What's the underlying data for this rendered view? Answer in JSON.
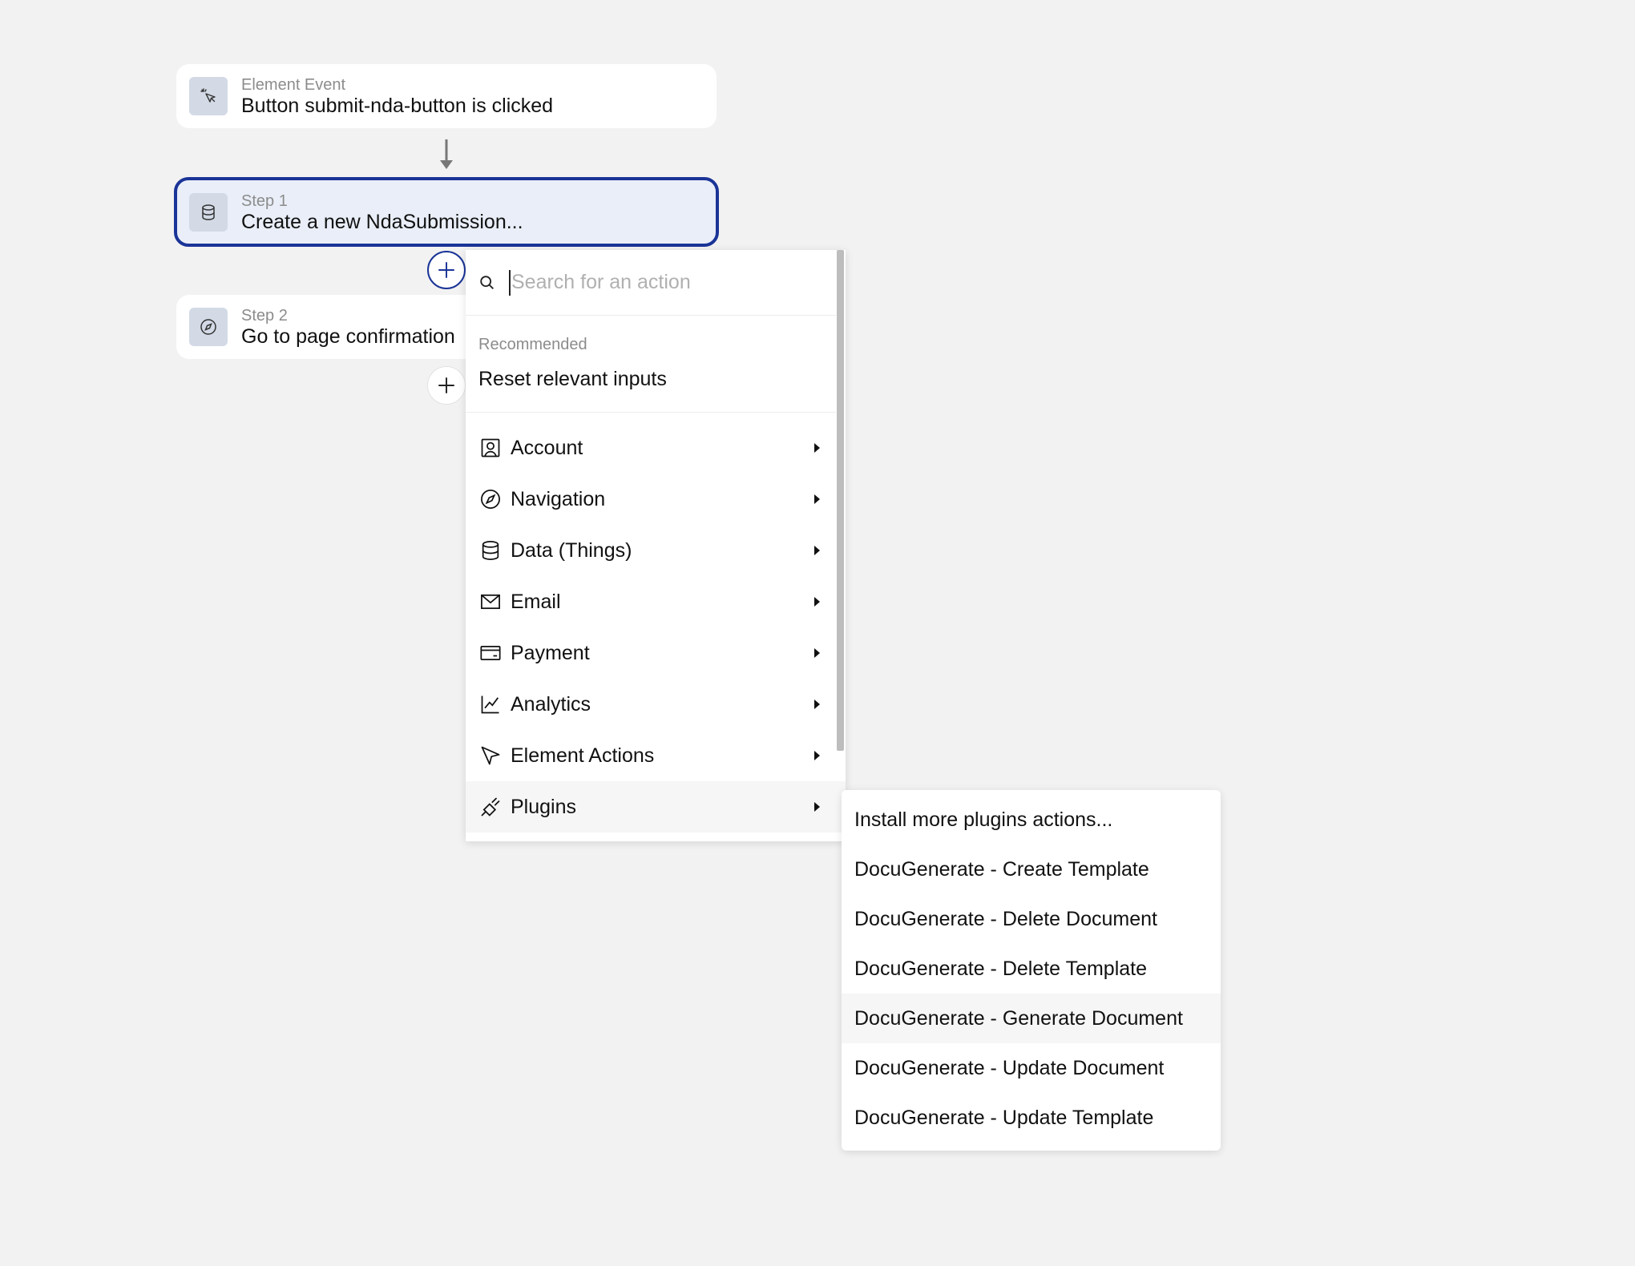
{
  "workflow": {
    "event": {
      "subtitle": "Element Event",
      "title": "Button submit-nda-button is clicked",
      "icon": "cursor-click-icon"
    },
    "steps": [
      {
        "subtitle": "Step 1",
        "title": "Create a new NdaSubmission...",
        "icon": "database-icon",
        "selected": true
      },
      {
        "subtitle": "Step 2",
        "title": "Go to page confirmation",
        "icon": "compass-icon",
        "selected": false
      }
    ]
  },
  "action_menu": {
    "search": {
      "placeholder": "Search for an action",
      "value": ""
    },
    "recommended_label": "Recommended",
    "recommended": [
      "Reset relevant inputs"
    ],
    "categories": [
      {
        "label": "Account",
        "icon": "account-icon"
      },
      {
        "label": "Navigation",
        "icon": "compass-icon"
      },
      {
        "label": "Data (Things)",
        "icon": "database-icon"
      },
      {
        "label": "Email",
        "icon": "envelope-icon"
      },
      {
        "label": "Payment",
        "icon": "credit-card-icon"
      },
      {
        "label": "Analytics",
        "icon": "line-chart-icon"
      },
      {
        "label": "Element Actions",
        "icon": "pointer-icon"
      },
      {
        "label": "Plugins",
        "icon": "plug-icon",
        "active": true
      }
    ]
  },
  "plugins_submenu": {
    "items": [
      "Install more plugins actions...",
      "DocuGenerate - Create Template",
      "DocuGenerate - Delete Document",
      "DocuGenerate - Delete Template",
      "DocuGenerate - Generate Document",
      "DocuGenerate - Update Document",
      "DocuGenerate - Update Template"
    ],
    "hovered_index": 4
  },
  "colors": {
    "accent": "#1a3497",
    "selected_bg": "#e9eef8",
    "canvas": "#f2f2f2",
    "icon_bg": "#d3dae6"
  }
}
